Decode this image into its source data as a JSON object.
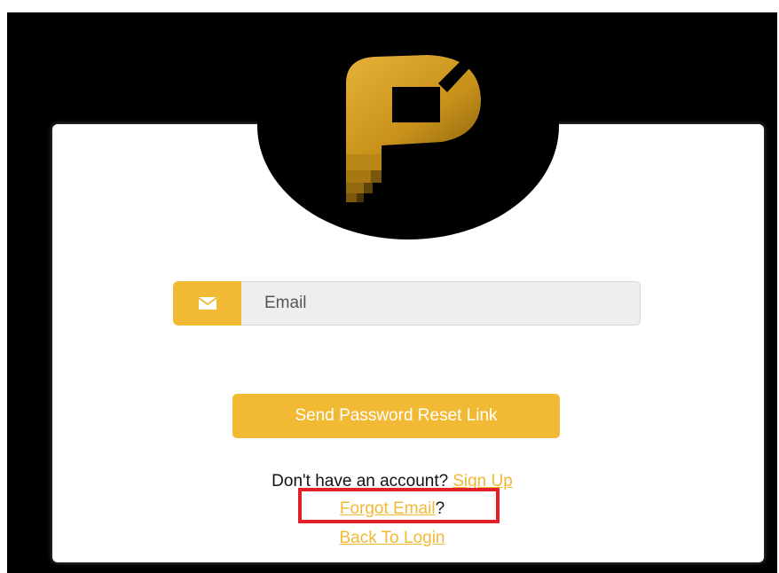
{
  "logo": {
    "name": "brand-logo",
    "colors": {
      "gold": "#d9a21f",
      "dark_gold": "#a87a12",
      "disc": "#000000"
    }
  },
  "form": {
    "email_icon": "envelope-icon",
    "email_placeholder": "Email",
    "submit_label": "Send Password Reset Link"
  },
  "links": {
    "signup_prompt": "Don't have an account?",
    "signup_label": "Sign Up",
    "forgot_email_label": "Forgot Email",
    "forgot_email_suffix": "?",
    "back_to_login_label": "Back To Login"
  },
  "colors": {
    "accent": "#f2b935",
    "highlight_box": "#e3202a",
    "background": "#000000",
    "card": "#ffffff"
  }
}
